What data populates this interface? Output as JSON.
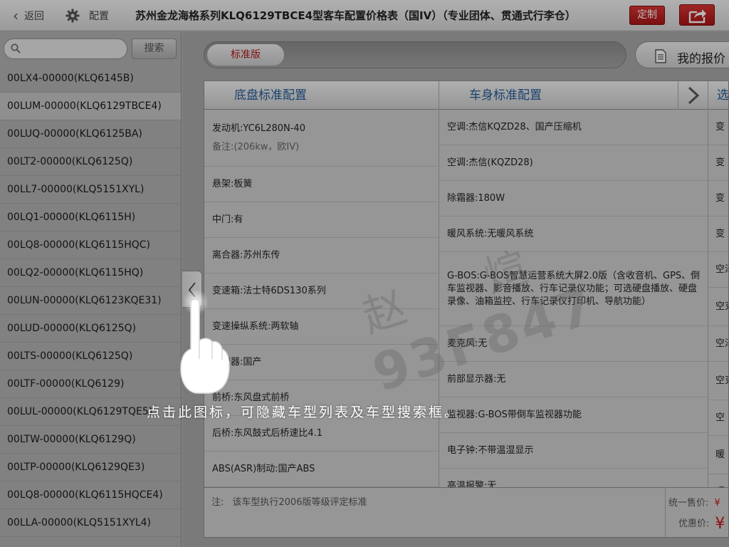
{
  "topbar": {
    "back_label": "返回",
    "config_label": "配置",
    "title": "苏州金龙海格系列KLQ6129TBCE4型客车配置价格表（国IV）（专业团体、贯通式行李仓）",
    "custom_label": "定制"
  },
  "sidebar": {
    "search": {
      "value": "",
      "placeholder": ""
    },
    "search_button": "搜索",
    "models": [
      {
        "label": "00LX4-00000(KLQ6145B)",
        "selected": false
      },
      {
        "label": "00LUM-00000(KLQ6129TBCE4)",
        "selected": true
      },
      {
        "label": "00LUQ-00000(KLQ6125BA)",
        "selected": false
      },
      {
        "label": "00LT2-00000(KLQ6125Q)",
        "selected": false
      },
      {
        "label": "00LL7-00000(KLQ5151XYL)",
        "selected": false
      },
      {
        "label": "00LQ1-00000(KLQ6115H)",
        "selected": false
      },
      {
        "label": "00LQ8-00000(KLQ6115HQC)",
        "selected": false
      },
      {
        "label": "00LQ2-00000(KLQ6115HQ)",
        "selected": false
      },
      {
        "label": "00LUN-00000(KLQ6123KQE31)",
        "selected": false
      },
      {
        "label": "00LUD-00000(KLQ6125Q)",
        "selected": false
      },
      {
        "label": "00LTS-00000(KLQ6125Q)",
        "selected": false
      },
      {
        "label": "00LTF-00000(KLQ6129)",
        "selected": false
      },
      {
        "label": "00LUL-00000(KLQ6129TQE5)",
        "selected": false
      },
      {
        "label": "00LTW-00000(KLQ6129Q)",
        "selected": false
      },
      {
        "label": "00LTP-00000(KLQ6129QE3)",
        "selected": false
      },
      {
        "label": "00LQ8-00000(KLQ6115HQCE4)",
        "selected": false
      },
      {
        "label": "00LLA-00000(KLQ5151XYL4)",
        "selected": false
      }
    ]
  },
  "main": {
    "tab_standard": "标准版",
    "my_quote_label": "我的报价",
    "columns": [
      {
        "header": "底盘标准配置",
        "cells": [
          {
            "text": "发动机:YC6L280N-40",
            "note": "备注:(206kw，欧IV)"
          },
          {
            "text": "悬架:板簧"
          },
          {
            "text": "中门:有"
          },
          {
            "text": "离合器:苏州东传"
          },
          {
            "text": "变速箱:法士特6DS130系列"
          },
          {
            "text": "变速操纵系统:两软轴"
          },
          {
            "text": "缓速器:国产"
          },
          {
            "text": "前桥:东风盘式前桥"
          },
          {
            "text": "后桥:东风鼓式后桥速比4.1"
          },
          {
            "text": "ABS(ASR)制动:国产ABS"
          }
        ]
      },
      {
        "header": "车身标准配置",
        "cells": [
          {
            "text": "空调:杰信KQZD28、国产压缩机"
          },
          {
            "text": "空调:杰信(KQZD28)"
          },
          {
            "text": "除霜器:180W"
          },
          {
            "text": "暖风系统:无暖风系统"
          },
          {
            "text": "G-BOS:G-BOS智慧运营系统大屏2.0版（含收音机、GPS、倒车监视器、影音播放、行车记录仪功能；可选硬盘播放、硬盘录像、油箱监控、行车记录仪打印机、导航功能）"
          },
          {
            "text": "麦克风:无"
          },
          {
            "text": "前部显示器:无"
          },
          {
            "text": "监视器:G-BOS带倒车监视器功能"
          },
          {
            "text": "电子钟:不带温湿显示"
          },
          {
            "text": "高温报警:无"
          }
        ]
      },
      {
        "header": "选",
        "cells": [
          "变",
          "变",
          "变",
          "变",
          "空泽",
          "空克",
          "空泽",
          "空克",
          "空",
          "暖",
          "暖"
        ]
      }
    ],
    "footer_note_label": "注:",
    "footer_note": "该车型执行2006版等级评定标准",
    "price": {
      "retail_label": "统一售价:",
      "discount_label": "优惠价:",
      "currency": "¥"
    }
  },
  "watermark": {
    "name": "赵 煊",
    "number": "93F847"
  },
  "tutorial": {
    "text": "点击此图标，可隐藏车型列表及车型搜索框。"
  }
}
